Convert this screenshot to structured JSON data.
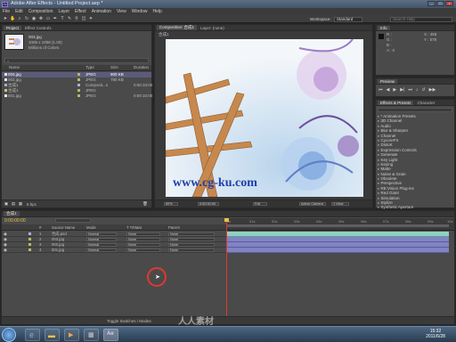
{
  "window": {
    "title": "Adobe After Effects - Untitled Project.aep *",
    "controls": [
      "_",
      "□",
      "×"
    ]
  },
  "menu": [
    "File",
    "Edit",
    "Composition",
    "Layer",
    "Effect",
    "Animation",
    "View",
    "Window",
    "Help"
  ],
  "toolbar": {
    "workspace_label": "Workspace:",
    "workspace_value": "Standard",
    "search_placeholder": "Search Help"
  },
  "project": {
    "tabs": [
      "Project",
      "Effect Controls"
    ],
    "selected_name": "003.jpg",
    "selected_info1": "1005 x 1008 (1.00)",
    "selected_info2": "Millions of Colors",
    "columns": [
      "Name",
      "Type",
      "Size",
      "Duration"
    ],
    "items": [
      {
        "name": "003.jpg",
        "type": "JPEG",
        "size": "900 KB",
        "duration": "",
        "color": "#b8b86a"
      },
      {
        "name": "002.jpg",
        "type": "JPEG",
        "size": "780 KB",
        "duration": "",
        "color": "#b8b86a"
      },
      {
        "name": "合成1",
        "type": "Composit...n",
        "size": "",
        "duration": "0:00:10:00",
        "color": "#b0b0d8"
      },
      {
        "name": "合成1",
        "type": "JPEG",
        "size": "",
        "duration": "",
        "color": "#b8b86a"
      },
      {
        "name": "001.jpg",
        "type": "JPEG",
        "size": "",
        "duration": "0:00:10:00",
        "color": "#b8b86a"
      }
    ],
    "footer": "8 bpc"
  },
  "composition": {
    "tabs": [
      "Composition: 合成1",
      "Layer: (none)"
    ],
    "breadcrumb": "合成1",
    "watermark": "www.cg-ku.com",
    "footer": {
      "zoom": "50%",
      "time": "0:00:00:00",
      "resolution": "Full",
      "camera": "Active Camera",
      "views": "1 View"
    }
  },
  "info": {
    "tab": "Info",
    "r": "R :",
    "g": "G :",
    "b": "B :",
    "a": "A : 0",
    "x": "X : 458",
    "y": "Y : 578"
  },
  "preview": {
    "tab": "Preview"
  },
  "effects": {
    "tab": "Effects & Presets",
    "tab2": "Character",
    "search": "",
    "items": [
      "* Animation Presets",
      "3D Channel",
      "Audio",
      "Blur & Sharpen",
      "Channel",
      "CycoreFX",
      "Distort",
      "Expression Controls",
      "Generate",
      "Key Light",
      "Keying",
      "Matte",
      "Noise & Grain",
      "Obsolete",
      "Perspective",
      "RE:Vision Plug-ins",
      "Red Giant",
      "Simulation",
      "Stylize",
      "Synthetic Aperture",
      "Text",
      "Time",
      "Transition",
      "Trapcode",
      "Utility"
    ]
  },
  "timeline": {
    "tab": "合成1",
    "timecode": "0:00:00:00",
    "columns": [
      "#",
      "Source Name",
      "Mode",
      "T TrkMat",
      "Parent"
    ],
    "ruler": [
      "0s",
      "01s",
      "02s",
      "03s",
      "04s",
      "05s",
      "06s",
      "07s",
      "08s",
      "09s",
      "10s"
    ],
    "layers": [
      {
        "num": "1",
        "name": "合成.psd",
        "mode": "Normal",
        "trkmat": "None",
        "parent": "None",
        "color": "#b0b0d8"
      },
      {
        "num": "2",
        "name": "003.jpg",
        "mode": "Normal",
        "trkmat": "None",
        "parent": "None",
        "color": "#b8b86a"
      },
      {
        "num": "3",
        "name": "002.jpg",
        "mode": "Normal",
        "trkmat": "None",
        "parent": "None",
        "color": "#b8b86a"
      },
      {
        "num": "4",
        "name": "001.jpg",
        "mode": "Normal",
        "trkmat": "None",
        "parent": "None",
        "color": "#b8b86a"
      }
    ],
    "bottom_button": "Toggle Switches / Modes"
  },
  "taskbar": {
    "time": "15:32",
    "date": "2011/6/28",
    "ae_label": "Ae"
  },
  "overlay": {
    "site_watermark": "人人素材"
  }
}
